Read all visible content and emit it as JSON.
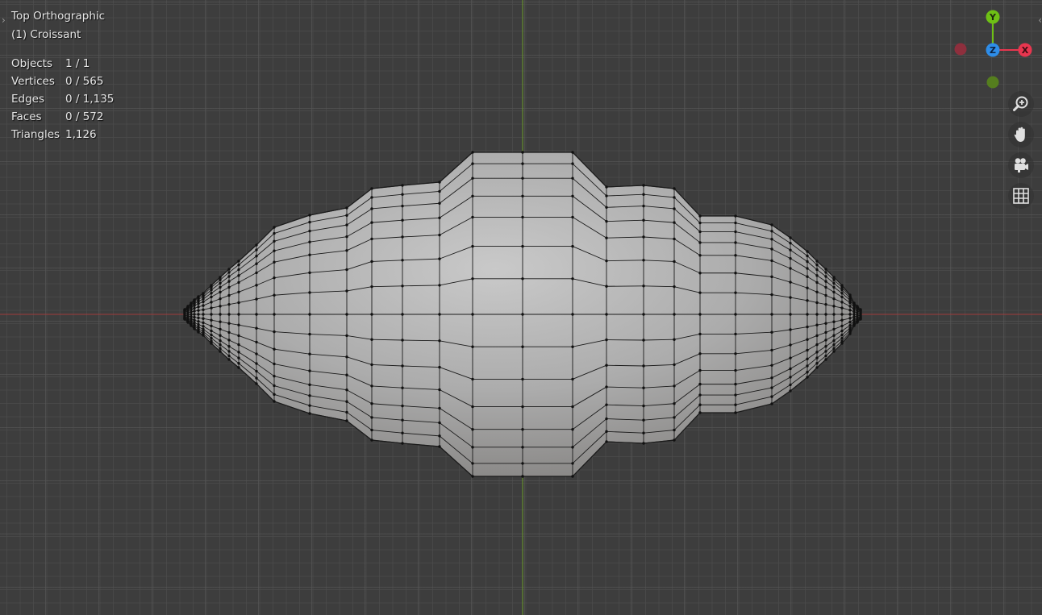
{
  "viewport": {
    "view_name": "Top Orthographic",
    "object_name": "(1) Croissant"
  },
  "stats": [
    {
      "label": "Objects",
      "value": "1 / 1"
    },
    {
      "label": "Vertices",
      "value": "0 / 565"
    },
    {
      "label": "Edges",
      "value": "0 / 1,135"
    },
    {
      "label": "Faces",
      "value": "0 / 572"
    },
    {
      "label": "Triangles",
      "value": "1,126"
    }
  ],
  "gizmo": {
    "axes": [
      {
        "label": "Y",
        "color": "#6ec015"
      },
      {
        "label": "Z",
        "color": "#2e8de8"
      },
      {
        "label": "X",
        "color": "#e8364f"
      }
    ],
    "negative_colors": {
      "x": "#8e2f3d",
      "y": "#557e1e"
    }
  },
  "nav_buttons": [
    "zoom-icon",
    "hand-pan-icon",
    "camera-icon",
    "grid-icon"
  ],
  "colors": {
    "background": "#3d3d3d",
    "x_axis_line": "#a03a3a",
    "y_axis_line": "#6a9a2a",
    "mesh_fill": "#a9a9a9",
    "wire": "#1b1b1b"
  }
}
